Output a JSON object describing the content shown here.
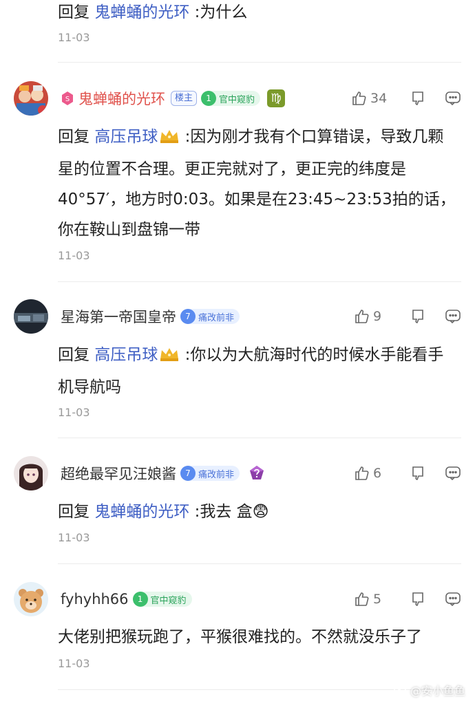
{
  "top": {
    "reply_word": "回复",
    "target": "鬼蝉蛹的光环",
    "text": ":为什么",
    "time": "11-03"
  },
  "comments": [
    {
      "user": "鬼蝉蛹的光环",
      "op_tag": "楼主",
      "fan_level": "1",
      "fan_name": "官中窥豹",
      "zodiac": "♍",
      "likes": "34",
      "reply_word": "回复",
      "target": "高压吊球",
      "text": ":因为刚才我有个口算错误，导致几颗星的位置不合理。更正完就对了，更正完的纬度是40°57′，地方时0:03。如果是在23:45~23:53拍的话，你在鞍山到盘锦一带",
      "time": "11-03"
    },
    {
      "user": "星海第一帝国皇帝",
      "fan_level": "7",
      "fan_name": "痛改前非",
      "likes": "9",
      "reply_word": "回复",
      "target": "高压吊球",
      "text": ":你以为大航海时代的时候水手能看手机导航吗",
      "time": "11-03"
    },
    {
      "user": "超绝最罕见汪娘酱",
      "fan_level": "7",
      "fan_name": "痛改前非",
      "likes": "6",
      "reply_word": "回复",
      "target": "鬼蝉蛹的光环",
      "text": ":我去 盒😨",
      "time": "11-03"
    },
    {
      "user": "fyhyhh66",
      "fan_level": "1",
      "fan_name": "官中窥豹",
      "likes": "5",
      "text": "大佬别把猴玩跑了，平猴很难找的。不然就没乐子了",
      "time": "11-03"
    }
  ],
  "watermark": "@安小鱼鱼",
  "colors": {
    "op_name": "#e0524c",
    "reply_target": "#3f5fc4",
    "time": "#999999"
  }
}
